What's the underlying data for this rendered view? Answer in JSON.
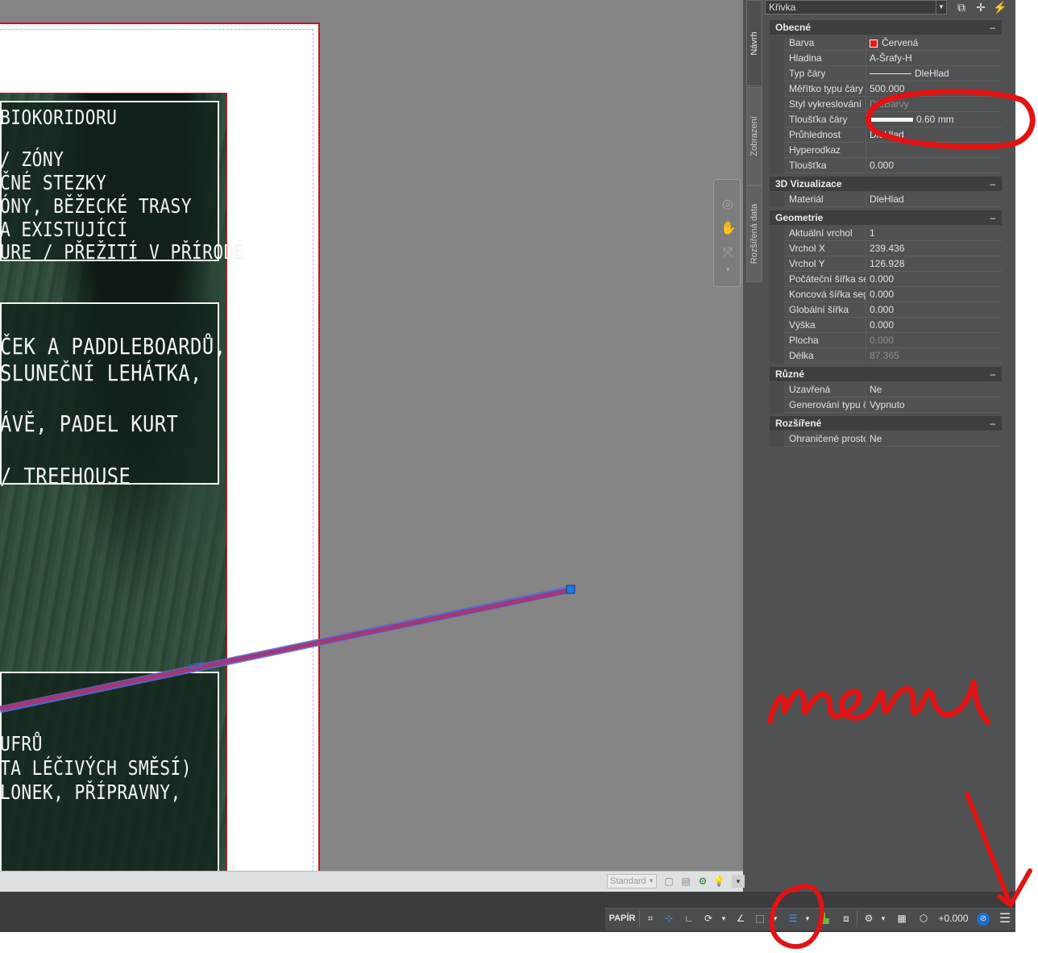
{
  "canvas": {
    "sheet_text": {
      "box1": [
        "BIOKORIDORU",
        "/ ZÓNY",
        "ČNÉ STEZKY",
        "ÓNY, BĚŽECKÉ TRASY",
        "A EXISTUJÍCÍ",
        "URE / PŘEŽITÍ V PŘÍRODĚ"
      ],
      "box2": [
        "ČEK A PADDLEBOARDŮ,",
        " SLUNEČNÍ LEHÁTKA,",
        "ÁVĚ, PADEL KURT",
        "/ TREEHOUSE"
      ],
      "box3": [
        "UFRŮ",
        "TA LÉČIVÝCH SMĚSÍ)",
        "LONEK, PŘÍPRAVNY,"
      ]
    }
  },
  "properties": {
    "object_type": "Křivka",
    "tabs": [
      "Návrh",
      "Zobrazení",
      "Rozšířená data"
    ],
    "sections": {
      "general": {
        "title": "Obecné",
        "rows": [
          {
            "name": "Barva",
            "value": "Červená"
          },
          {
            "name": "Hladina",
            "value": "A-Šrafy-H"
          },
          {
            "name": "Typ čáry",
            "value": "DleHlad"
          },
          {
            "name": "Měřítko typu čáry",
            "value": "500.000"
          },
          {
            "name": "Styl vykreslování",
            "value": "DleBarvy"
          },
          {
            "name": "Tloušťka čáry",
            "value": "0.60 mm"
          },
          {
            "name": "Průhlednost",
            "value": "DleHlad"
          },
          {
            "name": "Hyperodkaz",
            "value": ""
          },
          {
            "name": "Tloušťka",
            "value": "0.000"
          }
        ]
      },
      "viz3d": {
        "title": "3D Vizualizace",
        "rows": [
          {
            "name": "Materiál",
            "value": "DleHlad"
          }
        ]
      },
      "geometry": {
        "title": "Geometrie",
        "rows": [
          {
            "name": "Aktuální vrchol",
            "value": "1"
          },
          {
            "name": "Vrchol X",
            "value": "239.436"
          },
          {
            "name": "Vrchol Y",
            "value": "126.928"
          },
          {
            "name": "Počáteční šířka segmentu",
            "value": "0.000"
          },
          {
            "name": "Koncová šířka segmentu",
            "value": "0.000"
          },
          {
            "name": "Globální šířka",
            "value": "0.000"
          },
          {
            "name": "Výška",
            "value": "0.000"
          },
          {
            "name": "Plocha",
            "value": "0.000"
          },
          {
            "name": "Délka",
            "value": "87.365"
          }
        ]
      },
      "misc": {
        "title": "Různé",
        "rows": [
          {
            "name": "Uzavřená",
            "value": "Ne"
          },
          {
            "name": "Generování typu čáry",
            "value": "Vypnuto"
          }
        ]
      },
      "extended": {
        "title": "Rozšířené",
        "rows": [
          {
            "name": "Ohraničené prostory",
            "value": "Ne"
          }
        ]
      }
    },
    "collapse_symbol": "–"
  },
  "lower_toolbar": {
    "style_combo": "Standard"
  },
  "statusbar": {
    "paper_button": "PAPÍR",
    "transparency_value": "+0.000"
  },
  "annotations": {
    "handwritten_word": "menu"
  },
  "colors": {
    "selected_polyline": "#9c3a7a",
    "grip": "#1e7be0",
    "annotation_red": "#e01414",
    "panel_bg": "#505152"
  }
}
